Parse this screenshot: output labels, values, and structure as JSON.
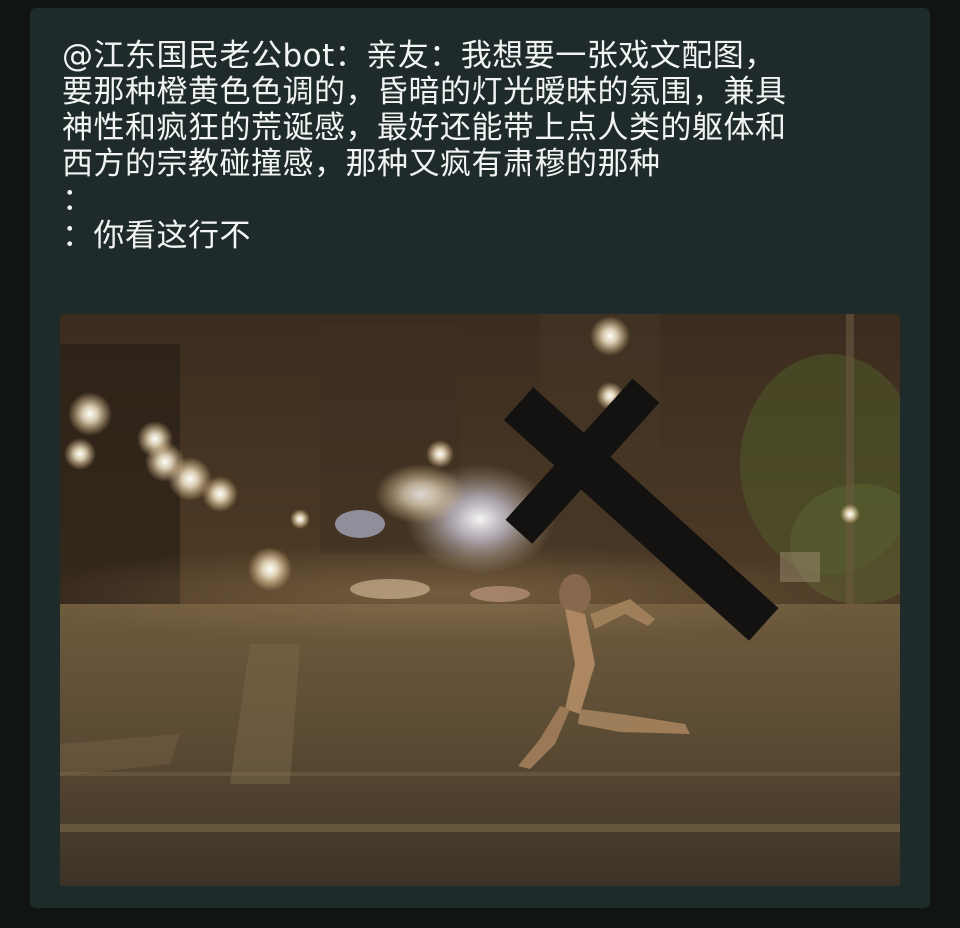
{
  "post": {
    "lines": [
      "@江东国民老公bot：亲友：我想要一张戏文配图，",
      "要那种橙黄色色调的，昏暗的灯光暧昧的氛围，兼具",
      "神性和疯狂的荒诞感，最好还能带上点人类的躯体和",
      "西方的宗教碰撞感，那种又疯有肃穆的那种",
      "：",
      "：你看这行不"
    ]
  },
  "photo": {
    "icon": "photo-icon",
    "description_visible": false
  },
  "colors": {
    "page_bg": "#101514",
    "card_bg": "#1e2b2a",
    "text": "#f2f4f3"
  }
}
